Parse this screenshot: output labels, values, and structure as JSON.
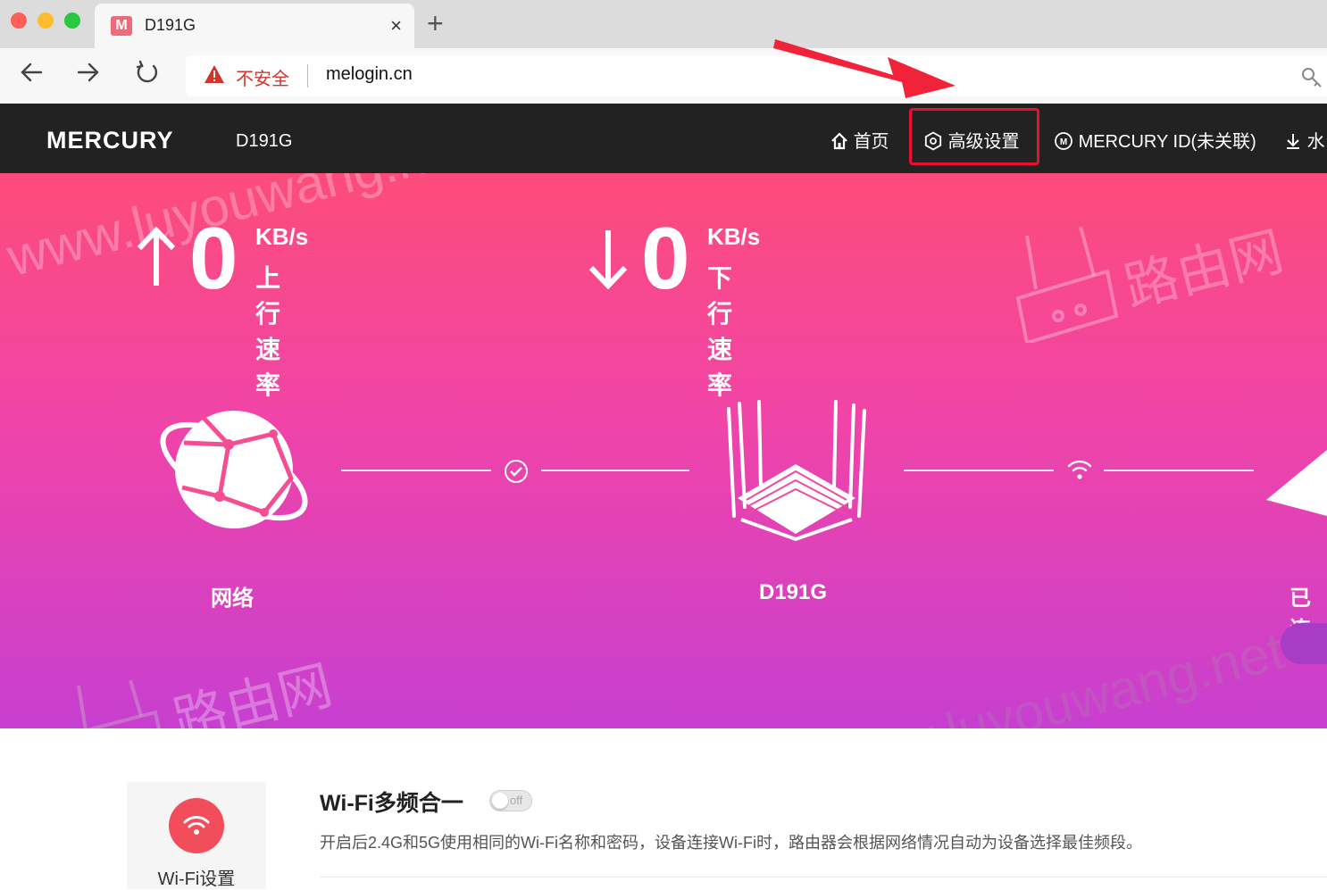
{
  "browser": {
    "tab_title": "D191G",
    "tab_favicon": "M",
    "new_tab_symbol": "+",
    "close_symbol": "×",
    "security_label": "不安全",
    "url": "melogin.cn",
    "icons": {
      "back": "back-arrow-icon",
      "forward": "forward-arrow-icon",
      "reload": "reload-icon",
      "warning": "warning-triangle-icon",
      "key": "key-icon"
    }
  },
  "header": {
    "brand": "MERCURY",
    "model": "D191G",
    "menu": [
      {
        "icon": "home-icon",
        "label": "首页"
      },
      {
        "icon": "gear-icon",
        "label": "高级设置"
      },
      {
        "icon": "mercury-id-icon",
        "label": "MERCURY ID(未关联)"
      },
      {
        "icon": "download-icon",
        "label": "水"
      }
    ]
  },
  "hero": {
    "upload": {
      "value": "0",
      "unit": "KB/s",
      "label": "上行速率"
    },
    "download": {
      "value": "0",
      "unit": "KB/s",
      "label": "下行速率"
    },
    "topology": {
      "internet_label": "网络",
      "router_label": "D191G",
      "clients_label": "已连"
    }
  },
  "watermark": {
    "site": "www.luyouwang.net",
    "brand": "路由网"
  },
  "feature": {
    "card_label": "Wi-Fi设置",
    "title": "Wi-Fi多频合一",
    "toggle_state": "off",
    "description": "开启后2.4G和5G使用相同的Wi-Fi名称和密码，设备连接Wi-Fi时，路由器会根据网络情况自动为设备选择最佳频段。"
  },
  "colors": {
    "header_bg": "#222222",
    "hero_top": "#fd4c7a",
    "hero_bottom": "#c73fd0",
    "annotation_red": "#e8112d",
    "wifi_card_red": "#f24d5a"
  }
}
